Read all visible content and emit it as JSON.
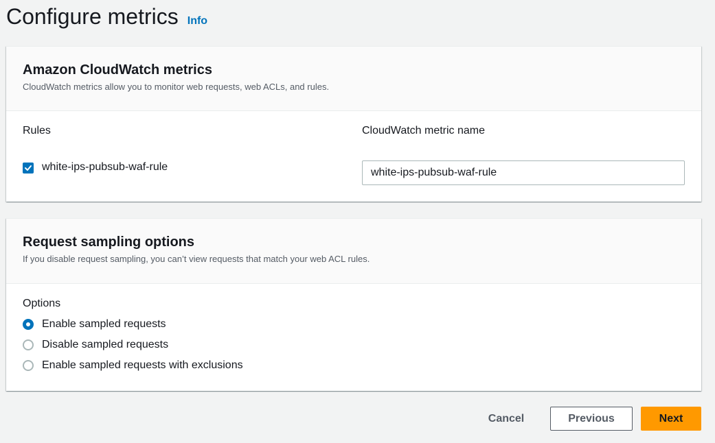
{
  "page": {
    "title": "Configure metrics",
    "info_link": "Info"
  },
  "cloudwatch": {
    "title": "Amazon CloudWatch metrics",
    "description": "CloudWatch metrics allow you to monitor web requests, web ACLs, and rules.",
    "rules_header": "Rules",
    "metric_name_header": "CloudWatch metric name",
    "rules": [
      {
        "name": "white-ips-pubsub-waf-rule",
        "checked": true,
        "metric_name": "white-ips-pubsub-waf-rule"
      }
    ]
  },
  "sampling": {
    "title": "Request sampling options",
    "description": "If you disable request sampling, you can’t view requests that match your web ACL rules.",
    "options_label": "Options",
    "options": [
      {
        "label": "Enable sampled requests",
        "selected": true
      },
      {
        "label": "Disable sampled requests",
        "selected": false
      },
      {
        "label": "Enable sampled requests with exclusions",
        "selected": false
      }
    ]
  },
  "footer": {
    "cancel_label": "Cancel",
    "previous_label": "Previous",
    "next_label": "Next"
  },
  "colors": {
    "accent_blue": "#0073bb",
    "primary_orange": "#ff9900",
    "background": "#f2f3f3"
  }
}
